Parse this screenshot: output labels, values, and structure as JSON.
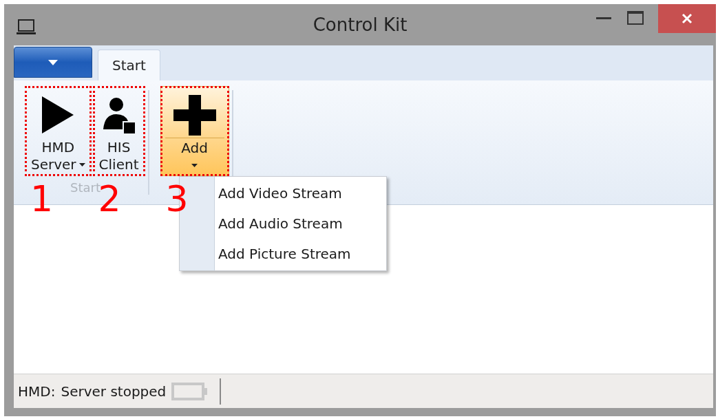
{
  "window": {
    "title": "Control Kit"
  },
  "ribbon": {
    "tabs": [
      {
        "label": "Start",
        "selected": true
      }
    ],
    "groups": [
      {
        "label": "Start",
        "buttons": [
          {
            "lines": [
              "HMD",
              "Server"
            ],
            "kind": "play",
            "dropdown": true,
            "highlighted": false,
            "annotation": "1"
          },
          {
            "lines": [
              "HIS",
              "Client"
            ],
            "kind": "user",
            "dropdown": false,
            "highlighted": false,
            "annotation": "2"
          }
        ]
      },
      {
        "buttons": [
          {
            "lines": [
              "Add"
            ],
            "kind": "plus",
            "dropdown": true,
            "highlighted": true,
            "annotation": "3"
          }
        ]
      }
    ]
  },
  "menu": {
    "items": [
      {
        "label": "Add Video Stream"
      },
      {
        "label": "Add Audio Stream"
      },
      {
        "label": "Add Picture Stream"
      }
    ]
  },
  "status_bar": {
    "label": "HMD:",
    "value": "Server stopped"
  }
}
